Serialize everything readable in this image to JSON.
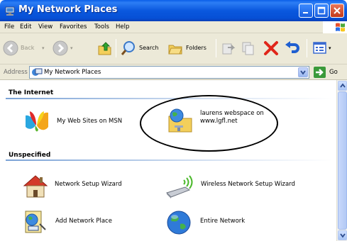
{
  "window": {
    "title": "My Network Places"
  },
  "menu": [
    {
      "label": "File"
    },
    {
      "label": "Edit"
    },
    {
      "label": "View"
    },
    {
      "label": "Favorites"
    },
    {
      "label": "Tools"
    },
    {
      "label": "Help"
    }
  ],
  "toolbar": {
    "back_label": "Back",
    "search_label": "Search",
    "folders_label": "Folders"
  },
  "address": {
    "label": "Address",
    "value": "My Network Places",
    "go_label": "Go"
  },
  "groups": {
    "internet": {
      "title": "The Internet",
      "items": [
        {
          "name": "My Web Sites on MSN",
          "icon": "msn-butterfly-icon"
        },
        {
          "name_line1": "laurens webspace on",
          "name_line2": "www.lgfl.net",
          "icon": "web-folder-icon"
        }
      ]
    },
    "unspecified": {
      "title": "Unspecified",
      "items": [
        {
          "name": "Network Setup Wizard",
          "icon": "network-setup-wizard-icon"
        },
        {
          "name": "Wireless Network Setup Wizard",
          "icon": "wireless-wizard-icon"
        },
        {
          "name": "Add Network Place",
          "icon": "add-network-place-icon"
        },
        {
          "name": "Entire Network",
          "icon": "globe-icon"
        }
      ]
    }
  },
  "colors": {
    "titlebar": "#0a58de",
    "group_line": "#7aa2d6"
  }
}
